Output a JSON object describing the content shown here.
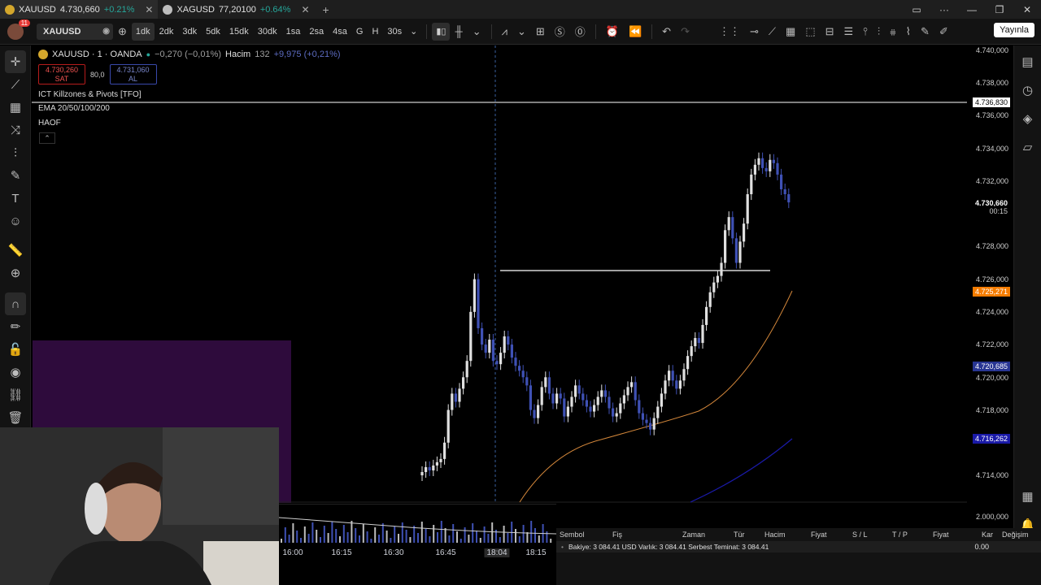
{
  "tabs": [
    {
      "symbol": "XAUUSD",
      "price": "4.730,660",
      "change": "+0.21%"
    },
    {
      "symbol": "XAGUSD",
      "price": "77,20100",
      "change": "+0.64%"
    }
  ],
  "toolbar": {
    "symbol": "XAUUSD",
    "notifications": "11",
    "intervals": [
      "1dk",
      "2dk",
      "3dk",
      "5dk",
      "15dk",
      "30dk",
      "1sa",
      "2sa",
      "4sa",
      "G",
      "H",
      "30s"
    ],
    "active_interval": "1dk",
    "publish_label": "Yayınla"
  },
  "legend": {
    "title": "XAUUSD · 1 · OANDA",
    "change": "−0,270 (−0,01%)",
    "volume_label": "Hacim",
    "volume_value": "132",
    "volume_change": "+9,975 (+0,21%)",
    "sell_price": "4.730,260",
    "sell_label": "SAT",
    "spread": "80,0",
    "buy_price": "4.731,060",
    "buy_label": "AL",
    "indicators": [
      "ICT Killzones & Pivots [TFO]",
      "EMA 20/50/100/200",
      "HAOF"
    ]
  },
  "price_axis": {
    "ticks": [
      "4.740,000",
      "4.738,000",
      "4.736,000",
      "4.734,000",
      "4.732,000",
      "4.728,000",
      "4.726,000",
      "4.724,000",
      "4.722,000",
      "4.720,000",
      "4.718,000",
      "4.714,000",
      "2.000,000"
    ],
    "last_price": "4.730,660",
    "countdown": "00:15",
    "hline_price": "4.736,830",
    "ema_orange": "4.725,271",
    "ema_blue1": "4.720,685",
    "ema_blue2": "4.716,262"
  },
  "time_axis": [
    "16:00",
    "16:15",
    "16:30",
    "16:45",
    "18:04",
    "18:15"
  ],
  "account_panel": {
    "headers": [
      "Sembol",
      "Fiş",
      "Zaman",
      "Tür",
      "Hacim",
      "Fiyat",
      "S / L",
      "T / P",
      "Fiyat",
      "Kar",
      "Değişim"
    ],
    "balance_row": "Bakiye: 3 084.41 USD  Varlık: 3 084.41  Serbest Teminat: 3 084.41",
    "pnl": "0.00"
  },
  "colors": {
    "up": "#e0e0e0",
    "down": "#3f51b5",
    "ema": "#d2863a",
    "accent": "#ff9800"
  }
}
